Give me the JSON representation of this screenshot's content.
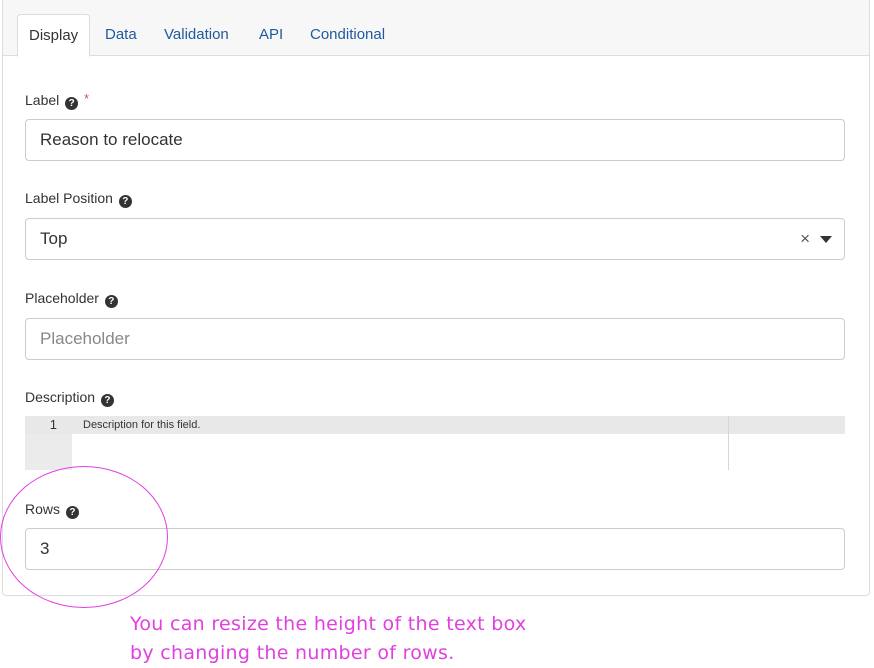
{
  "tabs": [
    {
      "label": "Display",
      "active": true
    },
    {
      "label": "Data",
      "active": false
    },
    {
      "label": "Validation",
      "active": false
    },
    {
      "label": "API",
      "active": false
    },
    {
      "label": "Conditional",
      "active": false
    }
  ],
  "fields": {
    "label": {
      "label": "Label",
      "required_mark": "*",
      "value": "Reason to relocate"
    },
    "label_position": {
      "label": "Label Position",
      "value": "Top",
      "clear_symbol": "×"
    },
    "placeholder": {
      "label": "Placeholder",
      "value": "",
      "placeholder": "Placeholder"
    },
    "description": {
      "label": "Description",
      "line_number": "1",
      "text": "Description for this field."
    },
    "rows": {
      "label": "Rows",
      "value": "3"
    }
  },
  "help_glyph": "?",
  "annotation": {
    "line1": "You can resize the height of the text box",
    "line2": "by changing the number of rows.",
    "color": "#e040e0"
  }
}
